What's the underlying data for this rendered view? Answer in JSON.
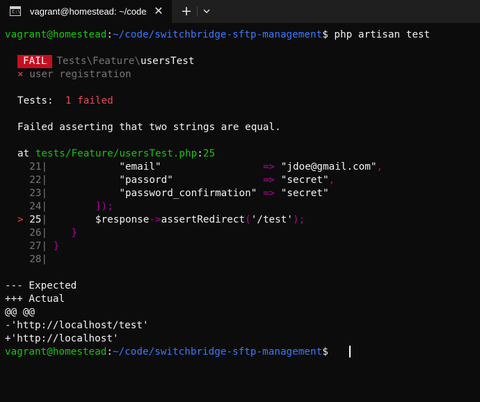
{
  "tab": {
    "title": "vagrant@homestead: ~/code/switchbridge-sftp-management",
    "icon_text": "C:\\",
    "new_tab": "+"
  },
  "prompt": {
    "user_host": "vagrant@homestead",
    "sep": ":",
    "path": "~/code/switchbridge-sftp-management",
    "symbol": "$",
    "command": "php artisan test"
  },
  "result": {
    "badge": "FAIL",
    "namespace": "Tests\\Feature\\",
    "class": "usersTest",
    "cross": "×",
    "case": "user registration"
  },
  "summary": {
    "label": "Tests:",
    "failed": "1 failed"
  },
  "message": "Failed asserting that two strings are equal.",
  "location": {
    "at": "at",
    "file": "tests/Feature/usersTest.php",
    "colon": ":",
    "line": "25"
  },
  "code_lines": [
    {
      "num": "21",
      "marker": "",
      "key": "\"email\"",
      "arrow": "=>",
      "value": "\"jdoe@gmail.com\"",
      "comma": ","
    },
    {
      "num": "22",
      "marker": "",
      "key": "\"passord\"",
      "arrow": "=>",
      "value": "\"secret\"",
      "comma": ","
    },
    {
      "num": "23",
      "marker": "",
      "key": "\"password_confirmation\"",
      "arrow": "=>",
      "value": "\"secret\"",
      "comma": ""
    },
    {
      "num": "24",
      "marker": "",
      "text": "]);"
    },
    {
      "num": "25",
      "marker": ">",
      "var": "$response",
      "arrow": "->",
      "method": "assertRedirect",
      "open": "(",
      "arg": "'/test'",
      "close": ");"
    },
    {
      "num": "26",
      "marker": "",
      "text": "}"
    },
    {
      "num": "27",
      "marker": "",
      "text": "}"
    },
    {
      "num": "28",
      "marker": "",
      "text": ""
    }
  ],
  "diff": [
    "--- Expected",
    "+++ Actual",
    "@@ @@",
    "-'http://localhost/test'",
    "+'http://localhost'"
  ],
  "colors": {
    "background": "#0c0c0c",
    "green": "#16c60c",
    "blue": "#3b78ff",
    "red": "#e74856",
    "magenta": "#b4009e",
    "fail_bg": "#c50f1f",
    "gray": "#767676"
  }
}
